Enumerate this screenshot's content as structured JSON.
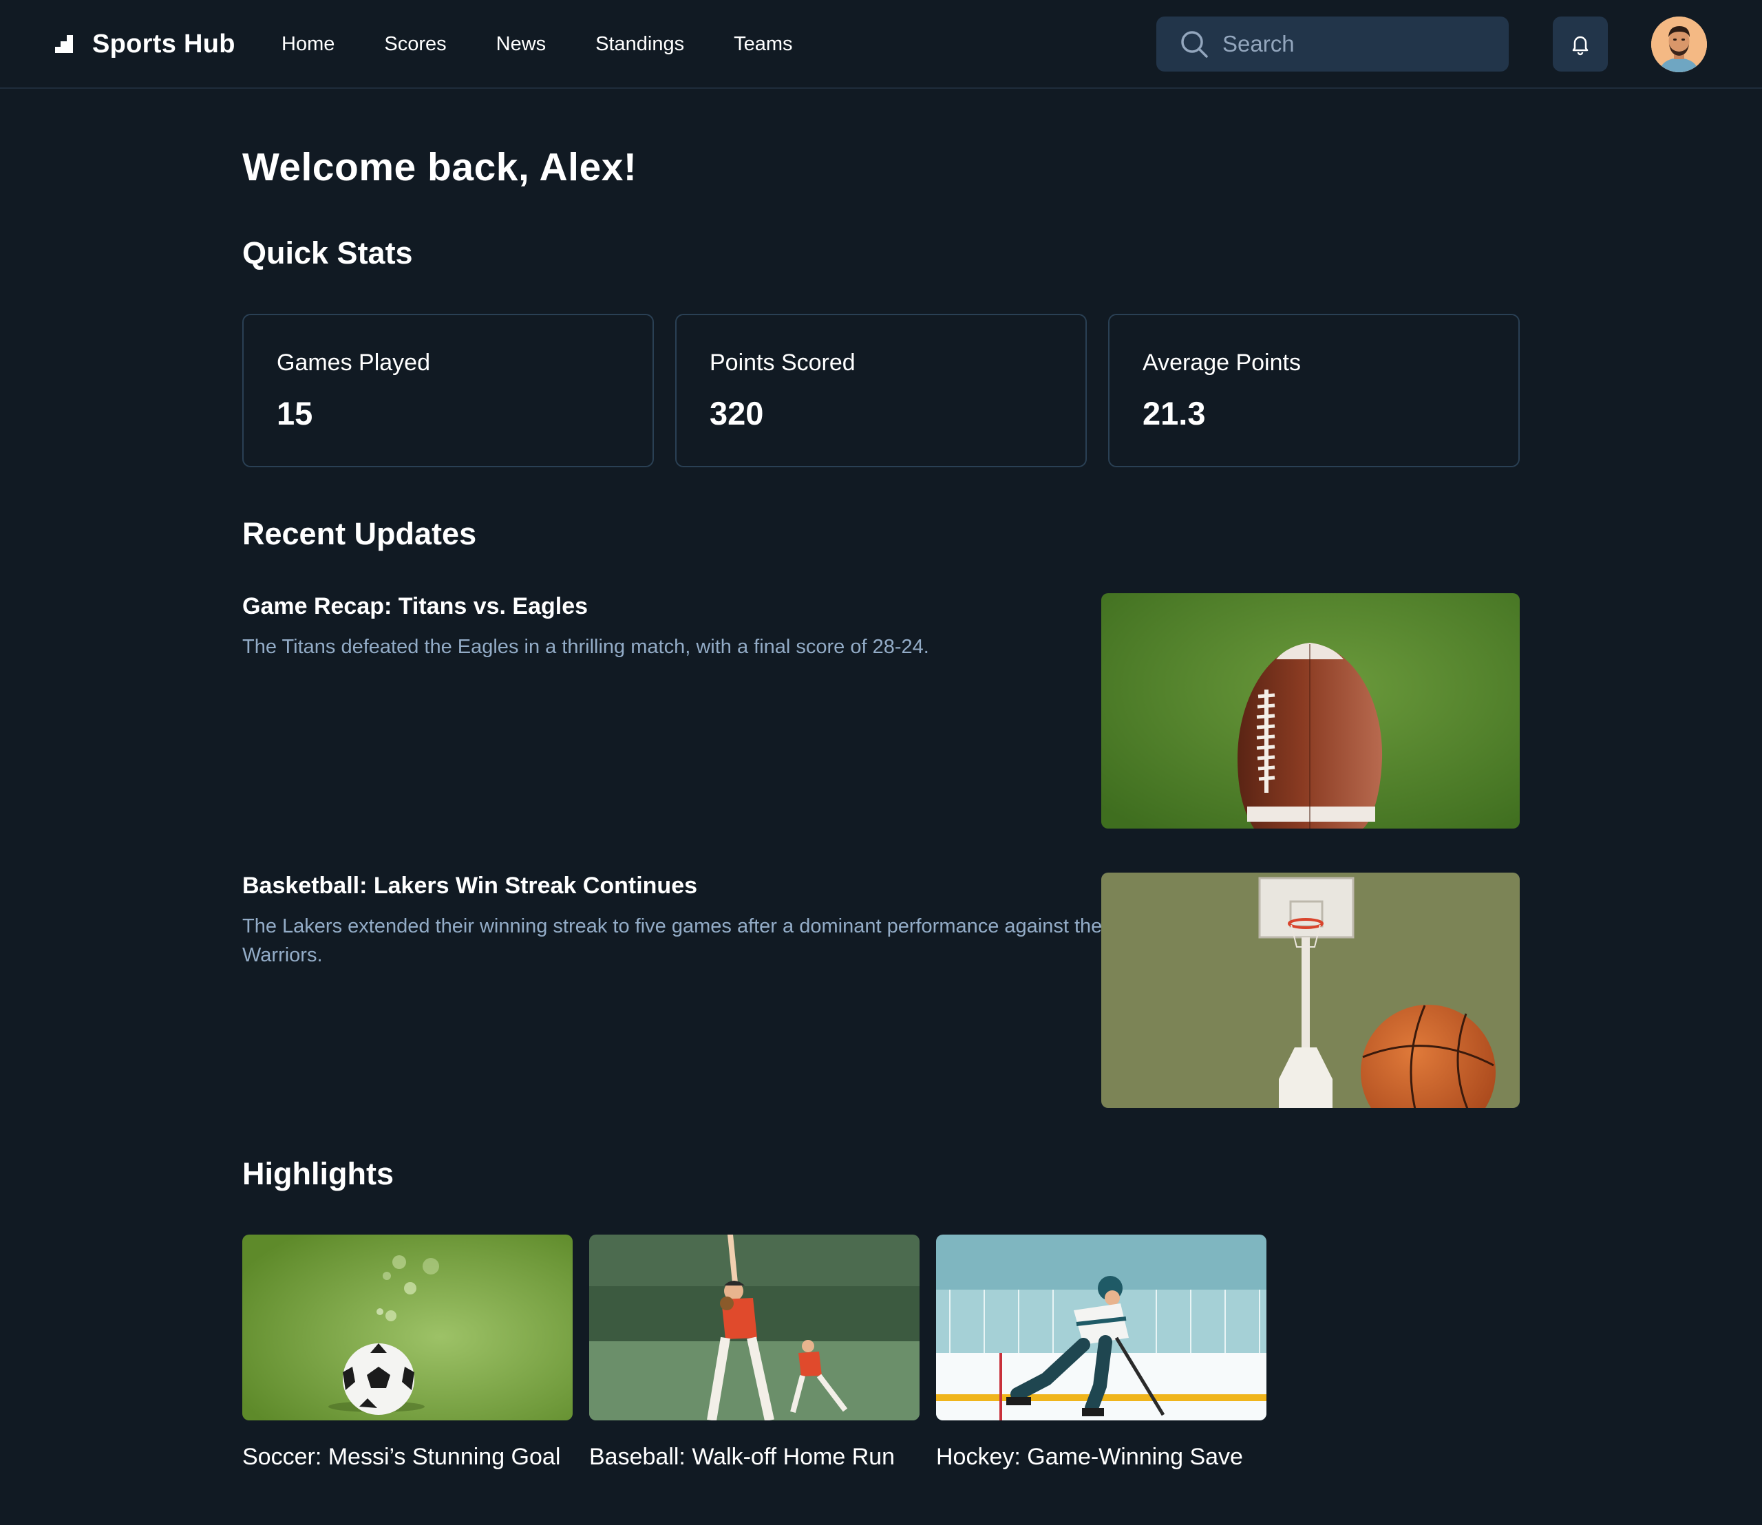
{
  "app": {
    "name": "Sports Hub",
    "colors": {
      "background": "#111a23",
      "surface": "#22354a",
      "border": "#2a4054",
      "muted_text": "#93acc7"
    }
  },
  "header": {
    "brand_icon": "logo-icon",
    "nav": [
      "Home",
      "Scores",
      "News",
      "Standings",
      "Teams"
    ],
    "search": {
      "placeholder": "Search",
      "value": "",
      "icon": "search-icon"
    },
    "notifications_icon": "bell-icon",
    "avatar_icon": "user-avatar"
  },
  "main": {
    "welcome": "Welcome back, Alex!",
    "quick_stats": {
      "title": "Quick Stats",
      "items": [
        {
          "label": "Games Played",
          "value": "15"
        },
        {
          "label": "Points Scored",
          "value": "320"
        },
        {
          "label": "Average Points",
          "value": "21.3"
        }
      ]
    },
    "recent_updates": {
      "title": "Recent Updates",
      "items": [
        {
          "title": "Game Recap: Titans vs. Eagles",
          "description": "The Titans defeated the Eagles in a thrilling match, with a final score of 28-24.",
          "image": "football-image"
        },
        {
          "title": "Basketball: Lakers Win Streak Continues",
          "description": "The Lakers extended their winning streak to five games after a dominant performance against the Warriors.",
          "image": "basketball-image"
        }
      ]
    },
    "highlights": {
      "title": "Highlights",
      "items": [
        {
          "caption": "Soccer: Messi’s Stunning Goal",
          "image": "soccer-image"
        },
        {
          "caption": "Baseball: Walk-off Home Run",
          "image": "baseball-image"
        },
        {
          "caption": "Hockey: Game-Winning Save",
          "image": "hockey-image"
        }
      ]
    }
  }
}
